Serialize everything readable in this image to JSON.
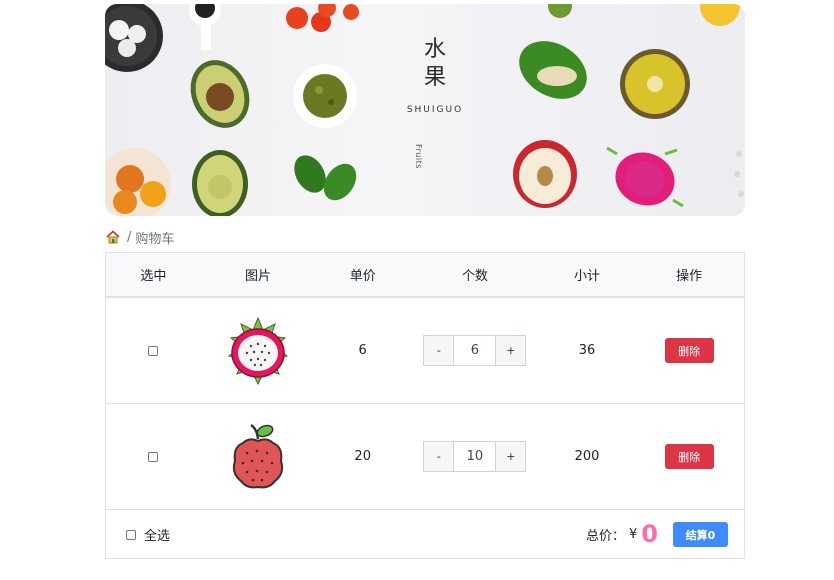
{
  "banner": {
    "title_line1": "水",
    "title_line2": "果",
    "subtitle": "SHUIGUO",
    "side_text": "Fruits"
  },
  "breadcrumb": {
    "home_icon": "home-icon",
    "separator": "/",
    "current": "购物车"
  },
  "table": {
    "headers": [
      "选中",
      "图片",
      "单价",
      "个数",
      "小计",
      "操作"
    ],
    "rows": [
      {
        "fruit_icon": "dragonfruit-icon",
        "price": "6",
        "count": "6",
        "subtotal": "36",
        "minus": "-",
        "plus": "+",
        "delete_label": "删除"
      },
      {
        "fruit_icon": "lychee-icon",
        "price": "20",
        "count": "10",
        "subtotal": "200",
        "minus": "-",
        "plus": "+",
        "delete_label": "删除"
      }
    ]
  },
  "footer": {
    "select_all_label": "全选",
    "total_label": "总价：",
    "currency": "¥",
    "total_value": "0",
    "checkout_label": "结算0"
  },
  "colors": {
    "delete": "#dc3545",
    "checkout": "#3d8bfd",
    "total": "#ff69b4"
  }
}
